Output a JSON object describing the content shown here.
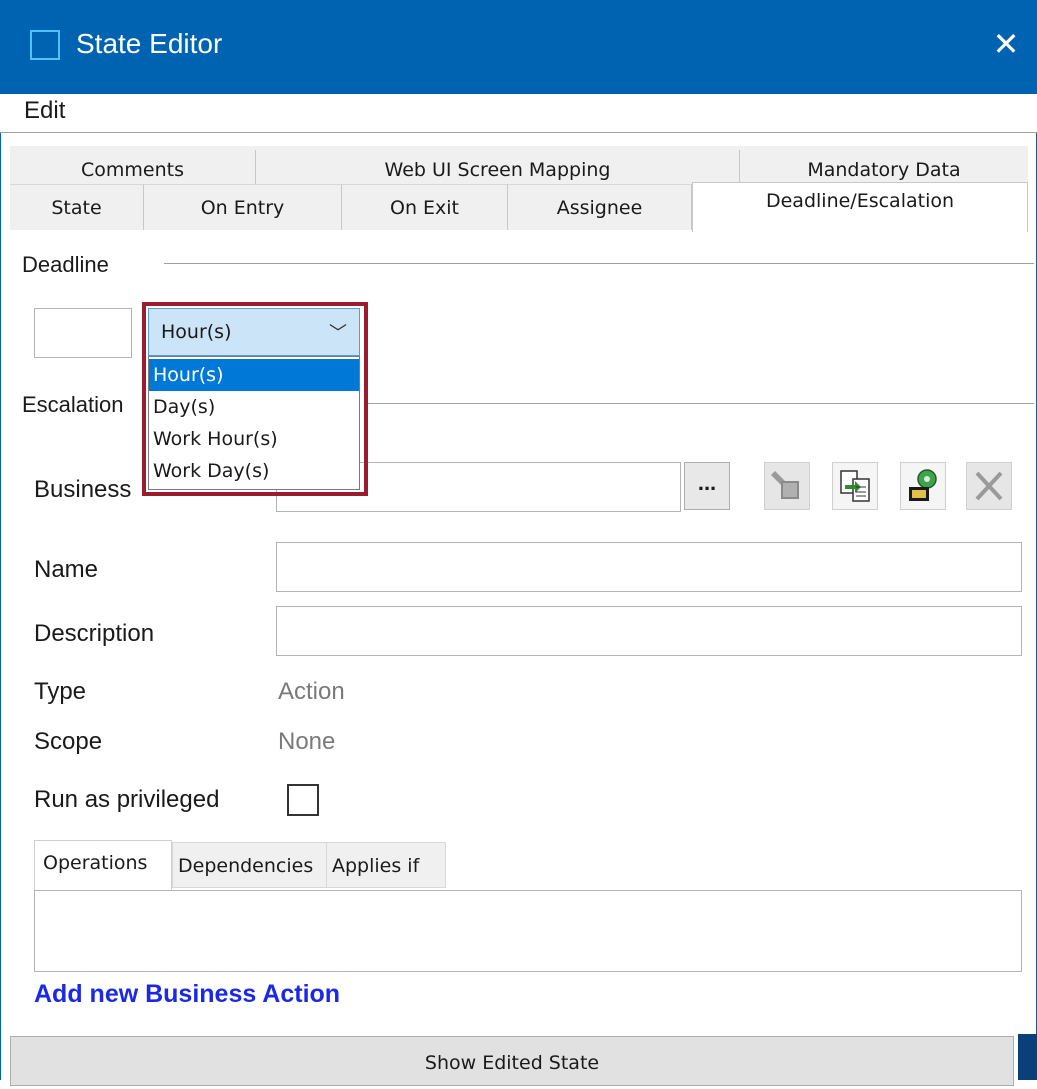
{
  "window": {
    "title": "State Editor",
    "close_glyph": "✕",
    "app_icon": "window-icon",
    "accent_color": "#0063b1"
  },
  "menu": {
    "items": [
      "Edit"
    ]
  },
  "tabs": {
    "row1": [
      "Comments",
      "Web UI Screen Mapping",
      "Mandatory Data"
    ],
    "row2": [
      "State",
      "On Entry",
      "On Exit",
      "Assignee",
      "Deadline/Escalation"
    ],
    "active": "Deadline/Escalation"
  },
  "deadline": {
    "section_label": "Deadline",
    "amount_value": "",
    "unit_selected": "Hour(s)",
    "unit_options": [
      "Hour(s)",
      "Day(s)",
      "Work Hour(s)",
      "Work Day(s)"
    ],
    "chevron_glyph": "﹀"
  },
  "escalation": {
    "section_label": "Escalation",
    "business_label": "Business",
    "business_value": "",
    "browse_label": "...",
    "toolbar_icons": [
      "edit-action-icon",
      "copy-action-icon",
      "run-action-icon",
      "delete-action-icon"
    ],
    "name_label": "Name",
    "name_value": "",
    "description_label": "Description",
    "description_value": "",
    "type_label": "Type",
    "type_value": "Action",
    "scope_label": "Scope",
    "scope_value": "None",
    "privileged_label": "Run as privileged",
    "privileged_checked": false
  },
  "subtabs": {
    "items": [
      "Operations",
      "Dependencies",
      "Applies if"
    ],
    "active": "Operations"
  },
  "link": {
    "add_action": "Add new Business Action",
    "color": "#1b29e6"
  },
  "footer": {
    "show_button": "Show Edited State"
  },
  "highlight_color": "#9b1c2e"
}
